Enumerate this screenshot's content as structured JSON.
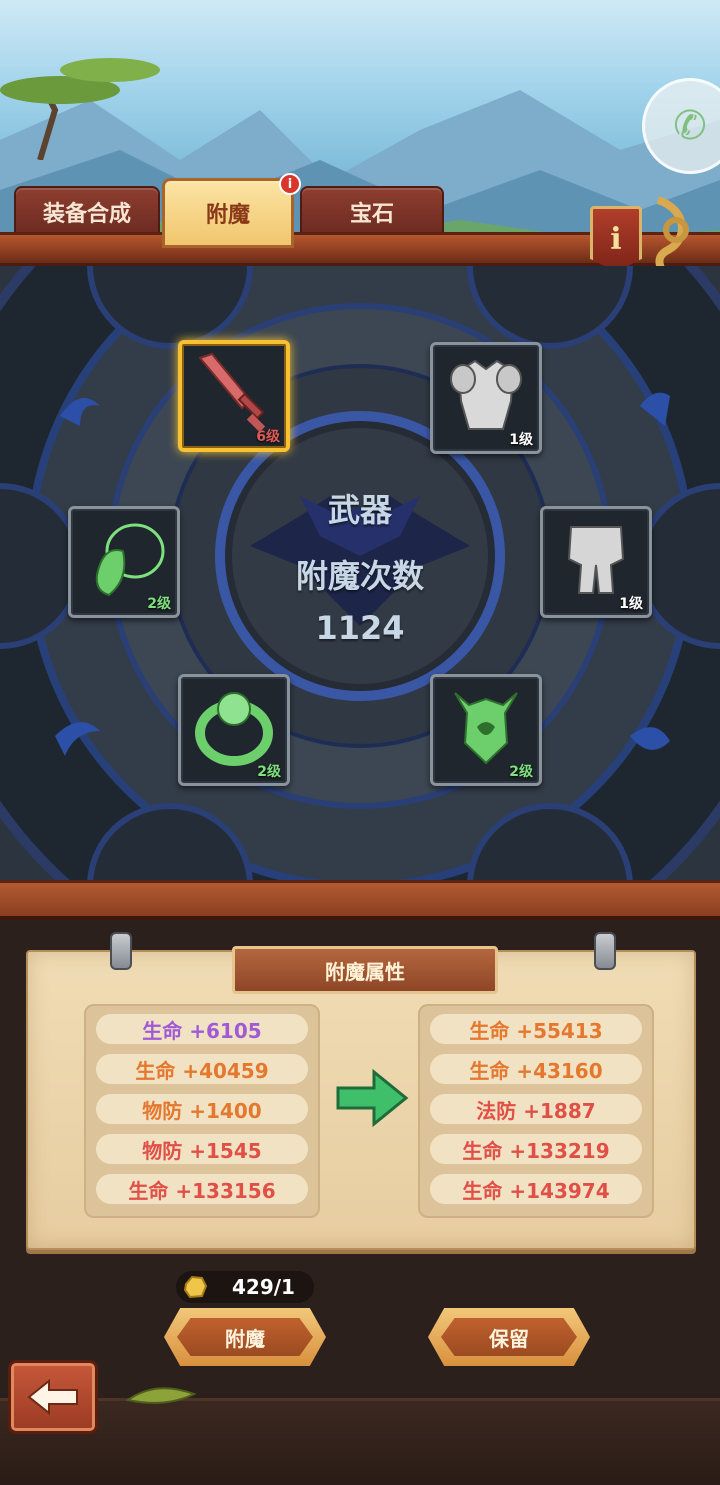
{
  "tabs": [
    {
      "label": "装备合成",
      "active": false
    },
    {
      "label": "附魔",
      "active": true,
      "badge": "i"
    },
    {
      "label": "宝石",
      "active": false
    }
  ],
  "info_button": {
    "label": "i"
  },
  "center": {
    "slot_name": "武器",
    "counter_label": "附魔次数",
    "counter_value": "1124"
  },
  "equipment_slots": [
    {
      "item": "sword",
      "level": "6级",
      "selected": true,
      "color": "#e05a5a"
    },
    {
      "item": "chest-armor",
      "level": "1级",
      "selected": false,
      "color": "#ffffff"
    },
    {
      "item": "amulet",
      "level": "2级",
      "selected": false,
      "color": "#7ee07e"
    },
    {
      "item": "leg-armor",
      "level": "1级",
      "selected": false,
      "color": "#ffffff"
    },
    {
      "item": "ring",
      "level": "2级",
      "selected": false,
      "color": "#7ee07e"
    },
    {
      "item": "helmet",
      "level": "2级",
      "selected": false,
      "color": "#7ee07e"
    }
  ],
  "enchant_panel": {
    "title": "附魔属性",
    "current": [
      {
        "text": "生命 +6105",
        "color": "#a05ad6"
      },
      {
        "text": "生命 +40459",
        "color": "#e4782e"
      },
      {
        "text": "物防 +1400",
        "color": "#e4782e"
      },
      {
        "text": "物防 +1545",
        "color": "#e05047"
      },
      {
        "text": "生命 +133156",
        "color": "#e05047"
      }
    ],
    "new": [
      {
        "text": "生命 +55413",
        "color": "#e4782e"
      },
      {
        "text": "生命 +43160",
        "color": "#e4782e"
      },
      {
        "text": "法防 +1887",
        "color": "#e05047"
      },
      {
        "text": "生命 +133219",
        "color": "#e05047"
      },
      {
        "text": "生命 +143974",
        "color": "#e05047"
      }
    ]
  },
  "currency": {
    "icon": "gold-stone-icon",
    "amount": "429/1"
  },
  "buttons": {
    "enchant": "附魔",
    "keep": "保留"
  }
}
